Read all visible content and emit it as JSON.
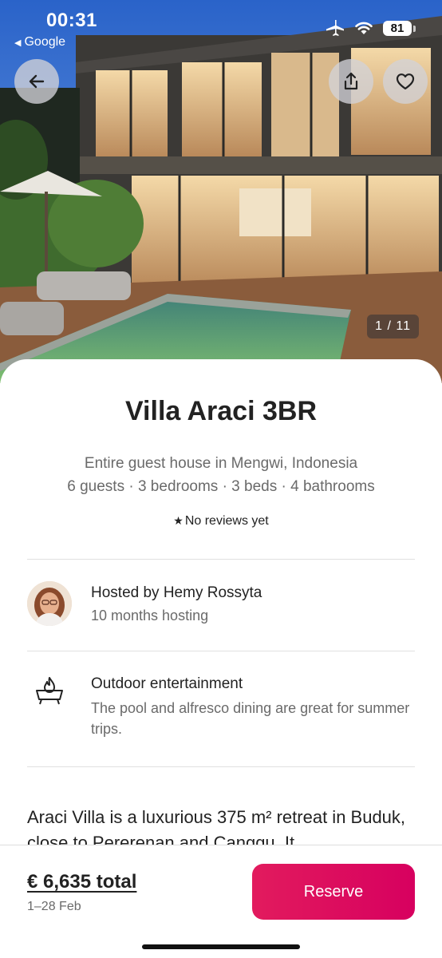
{
  "status_bar": {
    "time": "00:31",
    "back_app": "Google",
    "battery": "81",
    "icons": [
      "airplane-icon",
      "wifi-icon",
      "battery-icon"
    ]
  },
  "gallery": {
    "counter": "1 / 11"
  },
  "listing": {
    "title": "Villa Araci 3BR",
    "type_location": "Entire guest house in Mengwi, Indonesia",
    "capacity": "6 guests · 3 bedrooms · 3 beds · 4 bathrooms",
    "reviews": "No reviews yet"
  },
  "host": {
    "name": "Hosted by Hemy Rossyta",
    "meta": "10 months hosting"
  },
  "highlight": {
    "title": "Outdoor entertainment",
    "description": "The pool and alfresco dining are great for summer trips."
  },
  "description": "Araci Villa is a luxurious 375 m² retreat in Buduk, close to Pererenan and Canggu. It",
  "footer": {
    "price": "€ 6,635 total",
    "dates": "1–28 Feb",
    "reserve_label": "Reserve"
  },
  "colors": {
    "accent": "#DD1462",
    "text_primary": "#222222",
    "text_secondary": "#6A6A6A"
  }
}
